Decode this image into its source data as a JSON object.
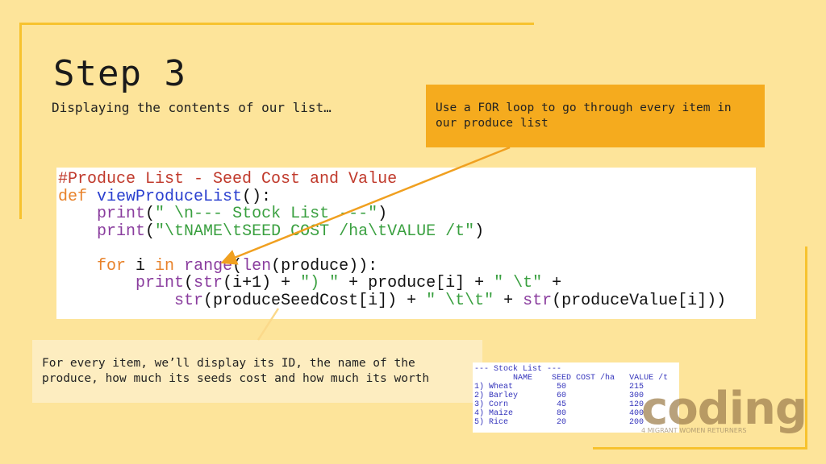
{
  "title": "Step 3",
  "subtitle": "Displaying the contents of our list…",
  "callout_for_loop": "Use a FOR loop to go through every item in our produce list",
  "callout_display": "For every item, we’ll display its ID, the name of the produce, how much its seeds cost and how much its worth",
  "colors": {
    "background": "#fde49a",
    "accent": "#f7c22e",
    "callout": "#f5ab1e",
    "comment": "#c0392b",
    "keyword": "#e8822a",
    "function": "#2a3fcf",
    "builtin": "#8a3d9e",
    "string": "#3aa040",
    "text": "#111111"
  },
  "code_lines": [
    [
      [
        "#Produce List - Seed Cost and Value",
        "comment"
      ]
    ],
    [
      [
        "def ",
        "keyword"
      ],
      [
        "viewProduceList",
        "function"
      ],
      [
        "():",
        "text"
      ]
    ],
    [
      [
        "    ",
        "text"
      ],
      [
        "print",
        "builtin"
      ],
      [
        "(",
        "text"
      ],
      [
        "\" \\n--- Stock List ---\"",
        "string"
      ],
      [
        ")",
        "text"
      ]
    ],
    [
      [
        "    ",
        "text"
      ],
      [
        "print",
        "builtin"
      ],
      [
        "(",
        "text"
      ],
      [
        "\"\\tNAME\\tSEED COST /ha\\tVALUE /t\"",
        "string"
      ],
      [
        ")",
        "text"
      ]
    ],
    [],
    [
      [
        "    ",
        "text"
      ],
      [
        "for",
        "keyword"
      ],
      [
        " i ",
        "text"
      ],
      [
        "in",
        "keyword"
      ],
      [
        " ",
        "text"
      ],
      [
        "range",
        "builtin"
      ],
      [
        "(",
        "text"
      ],
      [
        "len",
        "builtin"
      ],
      [
        "(produce)):",
        "text"
      ]
    ],
    [
      [
        "        ",
        "text"
      ],
      [
        "print",
        "builtin"
      ],
      [
        "(",
        "text"
      ],
      [
        "str",
        "builtin"
      ],
      [
        "(i+1) + ",
        "text"
      ],
      [
        "\") \"",
        "string"
      ],
      [
        " + produce[i] + ",
        "text"
      ],
      [
        "\" \\t\"",
        "string"
      ],
      [
        " +",
        "text"
      ]
    ],
    [
      [
        "            ",
        "text"
      ],
      [
        "str",
        "builtin"
      ],
      [
        "(produceSeedCost[i]) + ",
        "text"
      ],
      [
        "\" \\t\\t\"",
        "string"
      ],
      [
        " + ",
        "text"
      ],
      [
        "str",
        "builtin"
      ],
      [
        "(produceValue[i]))",
        "text"
      ]
    ]
  ],
  "output": {
    "header": "--- Stock List ---",
    "columns": [
      "NAME",
      "SEED COST /ha",
      "VALUE /t"
    ],
    "rows": [
      [
        "1)",
        "Wheat",
        "50",
        "215"
      ],
      [
        "2)",
        "Barley",
        "60",
        "300"
      ],
      [
        "3)",
        "Corn",
        "45",
        "120"
      ],
      [
        "4)",
        "Maize",
        "80",
        "400"
      ],
      [
        "5)",
        "Rice",
        "20",
        "200"
      ]
    ]
  },
  "logo": {
    "word": "coding",
    "tagline": "4 MIGRANT WOMEN RETURNERS"
  }
}
